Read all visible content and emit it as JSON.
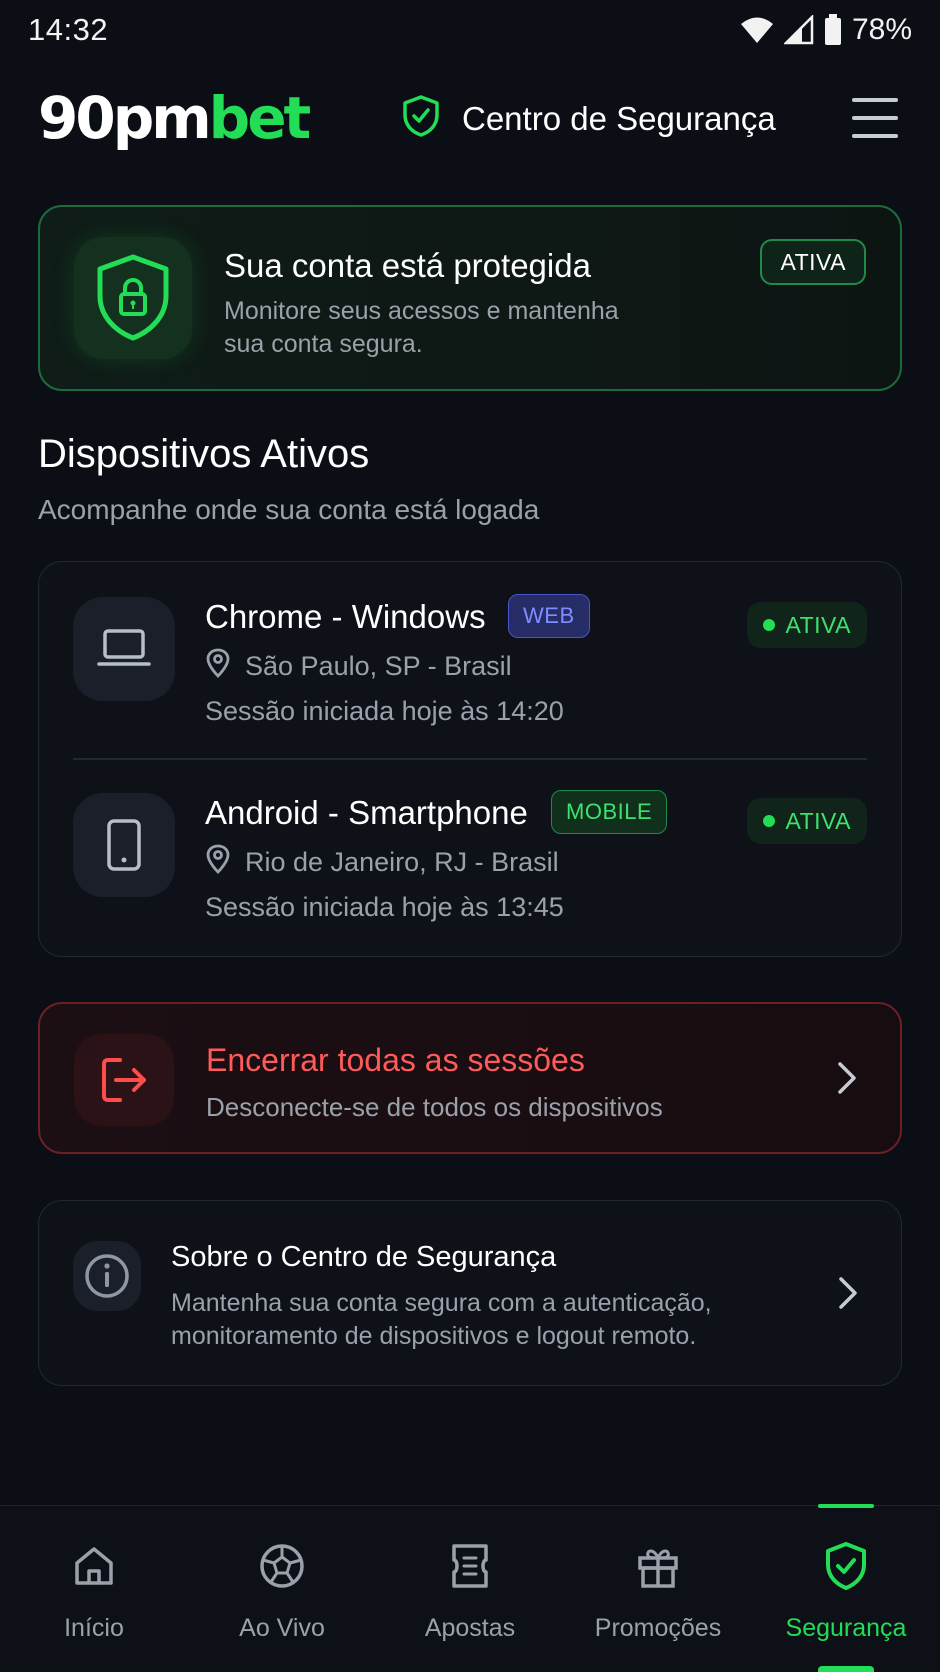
{
  "status_bar": {
    "time": "14:32",
    "battery": "78%"
  },
  "header": {
    "logo_part1": "90pm",
    "logo_part2": "bet",
    "title": "Centro de Segurança"
  },
  "protection": {
    "title": "Sua conta está protegida",
    "description": "Monitore seus acessos e mantenha sua conta segura.",
    "badge": "ATIVA"
  },
  "devices_section": {
    "title": "Dispositivos Ativos",
    "subtitle": "Acompanhe onde sua conta está logada"
  },
  "devices": [
    {
      "name": "Chrome - Windows",
      "tag": "WEB",
      "location": "São Paulo, SP - Brasil",
      "session": "Sessão iniciada hoje às 14:20",
      "status": "ATIVA"
    },
    {
      "name": "Android - Smartphone",
      "tag": "MOBILE",
      "location": "Rio de Janeiro, RJ - Brasil",
      "session": "Sessão iniciada hoje às 13:45",
      "status": "ATIVA"
    }
  ],
  "logout_all": {
    "title": "Encerrar todas as sessões",
    "description": "Desconecte-se de todos os dispositivos"
  },
  "about": {
    "title": "Sobre o Centro de Segurança",
    "description": "Mantenha sua conta segura com a autenticação, monitoramento de dispositivos e logout remoto."
  },
  "bottom_nav": [
    {
      "label": "Início",
      "icon": "home-icon"
    },
    {
      "label": "Ao Vivo",
      "icon": "soccer-ball-icon"
    },
    {
      "label": "Apostas",
      "icon": "ticket-icon"
    },
    {
      "label": "Promoções",
      "icon": "gift-icon"
    },
    {
      "label": "Segurança",
      "icon": "shield-check-icon",
      "active": true
    }
  ],
  "colors": {
    "accent": "#22dd55",
    "danger": "#ff5a5a",
    "background": "#0b0e14",
    "web_tag": "#7f8cff"
  }
}
